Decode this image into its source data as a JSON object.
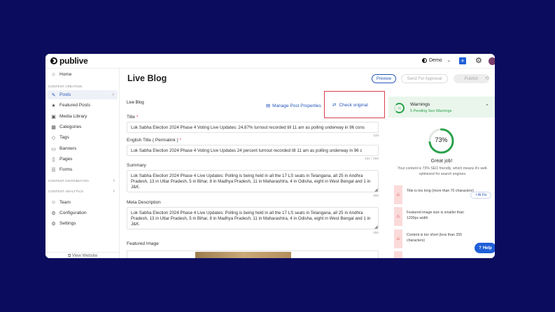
{
  "brand": {
    "name": "publive"
  },
  "topbar": {
    "workspace": "Demo",
    "plus": "+",
    "avatar_color": "#7a3e6b"
  },
  "sidebar": {
    "home": "Home",
    "section_creation": "CONTENT CREATION",
    "creation_items": [
      {
        "label": "Posts",
        "icon": "✎"
      },
      {
        "label": "Featured Posts",
        "icon": "★"
      },
      {
        "label": "Media Library",
        "icon": "▣"
      },
      {
        "label": "Categories",
        "icon": "▦"
      },
      {
        "label": "Tags",
        "icon": "◇"
      },
      {
        "label": "Banners",
        "icon": "▭"
      },
      {
        "label": "Pages",
        "icon": "▯"
      },
      {
        "label": "Forms",
        "icon": "☰"
      }
    ],
    "section_distribution": "CONTENT DISTRIBUTION",
    "section_analytics": "CONTENT ANALYTICS",
    "bottom_items": [
      {
        "label": "Team",
        "icon": "☺"
      },
      {
        "label": "Configuration",
        "icon": "⚙"
      },
      {
        "label": "Settings",
        "icon": "⚙"
      }
    ],
    "view_website": "View Website"
  },
  "header": {
    "title": "Live Blog",
    "preview": "Preview",
    "send_for_approval": "Send For Approval",
    "publish": "Publish"
  },
  "editor": {
    "section_title": "Live Blog",
    "manage_link": "Manage Post Properties",
    "check_link": "Check original",
    "title_label": "Title",
    "title_value": "Lok Sabha Election 2024 Phase 4 Voting Live Updates: 24.87% turnout recorded till 11 am as polling underway in 96 cons",
    "title_count": "128",
    "english_title_label": "English Title ( Permalink )",
    "english_title_value": "Lok Sabha Election 2024 Phase 4 Voting Live Updates 24 percent turnout recorded till 11 am as polling underway in 96 c",
    "english_title_count": "131 / 250",
    "summary_label": "Summary",
    "summary_value": "Lok Sabha Election 2024 Phase 4 Live Updates: Polling is being held in all the 17 LS seats in Telangana, all 25 in Andhra Pradesh, 13 in Uttar Pradesh, 5 in Bihar, 8 in Madhya Pradesh, 11 in Maharashtra, 4 in Odisha, eight in West Bengal and 1 in J&K.",
    "summary_count": "250",
    "meta_label": "Meta Description",
    "meta_value": "Lok Sabha Election 2024 Phase 4 Live Updates: Polling is being held in all the 17 LS seats in Telangana, all 25 in Andhra Pradesh, 13 in Uttar Pradesh, 5 in Bihar, 8 in Madhya Pradesh, 11 in Maharashtra, 4 in Odisha, eight in West Bengal and 1 in J&K.",
    "meta_count": "250",
    "featured_image_label": "Featured Image"
  },
  "seo": {
    "ring_small": "73",
    "warnings_title": "Warnings",
    "warnings_sub": "5 Pending Seo Warnings",
    "score_label": "73%",
    "score_fraction": 0.73,
    "great": "Great job!",
    "desc": "Your content is 73% SEO friendly, which means it's well-optimized for search engines.",
    "issues": [
      {
        "text": "Title is too long (more than 70 characters)",
        "fix": "AI Fix"
      },
      {
        "text": "Featured image size is smaller than 1200px width"
      },
      {
        "text": "Content is too short (less than 255 characters)"
      }
    ]
  },
  "help": "Help",
  "colors": {
    "background": "#0c0c5e",
    "accent": "#2456b8",
    "success": "#29a14a",
    "danger": "#d9414d"
  }
}
